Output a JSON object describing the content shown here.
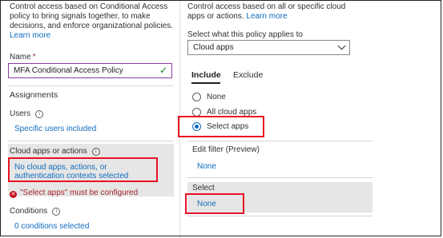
{
  "left": {
    "intro_text": "Control access based on Conditional Access policy to bring signals together, to make decisions, and enforce organizational policies.",
    "learn_more": "Learn more",
    "name_label": "Name",
    "name_required": "*",
    "name_value": "MFA Conditional Access Policy",
    "assignments_heading": "Assignments",
    "users_label": "Users",
    "users_value": "Specific users included",
    "cloud_label": "Cloud apps or actions",
    "cloud_value": "No cloud apps, actions, or authentication contexts selected",
    "error_text": "\"Select apps\" must be configured",
    "conditions_label": "Conditions",
    "conditions_value": "0 conditions selected"
  },
  "right": {
    "intro_text": "Control access based on all or specific cloud apps or actions.",
    "learn_more": "Learn more",
    "applies_label": "Select what this policy applies to",
    "applies_value": "Cloud apps",
    "tabs": [
      "Include",
      "Exclude"
    ],
    "radios": [
      {
        "label": "None",
        "checked": false
      },
      {
        "label": "All cloud apps",
        "checked": false
      },
      {
        "label": "Select apps",
        "checked": true
      }
    ],
    "filter_label": "Edit filter (Preview)",
    "filter_value": "None",
    "select_label": "Select",
    "select_value": "None"
  },
  "colors": {
    "link": "#0f6cbd",
    "error": "#a4262c",
    "highlight_box": "#e81123",
    "selected_row_bg": "#e7e6e6",
    "input_border_focus": "#8a3fa0"
  }
}
